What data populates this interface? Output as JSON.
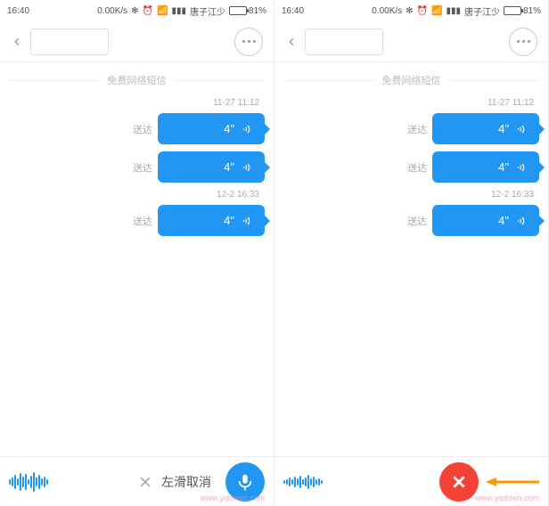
{
  "status": {
    "time": "16:40",
    "net": "0.00K/s",
    "carrier": "唐子江少",
    "battery_pct": "81%"
  },
  "chat": {
    "divider_label": "免费网络短信",
    "status_delivered": "送达",
    "ts1": "11-27 11:12",
    "ts2": "12-2 16:33",
    "duration": "4\""
  },
  "toolbar_left": {
    "hint": "左滑取消"
  },
  "watermark": "www.yqdown.com"
}
